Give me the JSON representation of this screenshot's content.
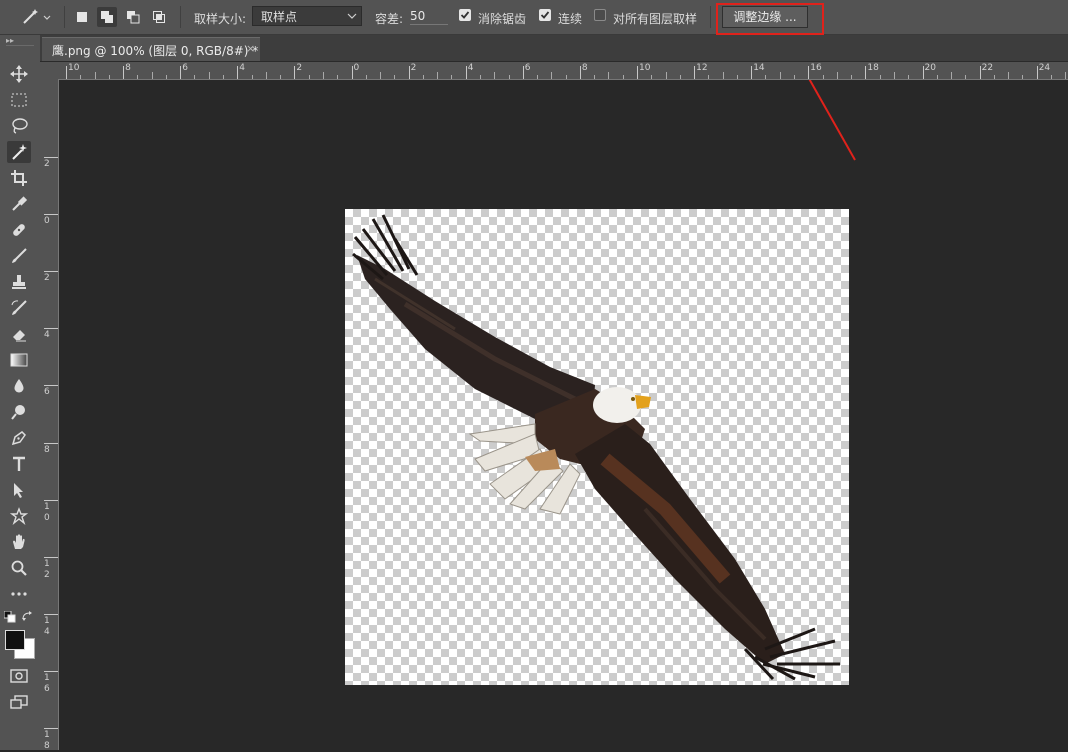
{
  "options_bar": {
    "sample_size_label": "取样大小:",
    "sample_size_value": "取样点",
    "tolerance_label": "容差:",
    "tolerance_value": "50",
    "anti_alias": {
      "label": "消除锯齿",
      "checked": true
    },
    "contiguous": {
      "label": "连续",
      "checked": true
    },
    "sample_all_layers": {
      "label": "对所有图层取样",
      "checked": false
    },
    "refine_edge_label": "调整边缘 ..."
  },
  "document_tab": {
    "title": "鹰.png @ 100% (图层 0, RGB/8#) *",
    "close": "×"
  },
  "horizontal_ruler": [
    "10",
    "8",
    "6",
    "4",
    "2",
    "0",
    "2",
    "4",
    "6",
    "8",
    "10",
    "12",
    "14",
    "16",
    "18",
    "20",
    "22",
    "24"
  ],
  "vertical_ruler": [
    "2",
    "0",
    "2",
    "4",
    "6",
    "8",
    "1 0",
    "1 2",
    "1 4",
    "1 6",
    "1 8"
  ],
  "colors": {
    "annotation_red": "#e0221b",
    "ui_panel": "#535353",
    "workspace": "#282828"
  },
  "icons": [
    "magic-wand",
    "move",
    "marquee",
    "lasso",
    "quick-select",
    "crop",
    "eyedropper",
    "healing",
    "brush",
    "stamp",
    "history-brush",
    "eraser",
    "gradient",
    "blur",
    "dodge",
    "pen",
    "type",
    "path-select",
    "shape",
    "hand",
    "zoom",
    "more",
    "colors",
    "quick-mask",
    "screen-mode"
  ]
}
